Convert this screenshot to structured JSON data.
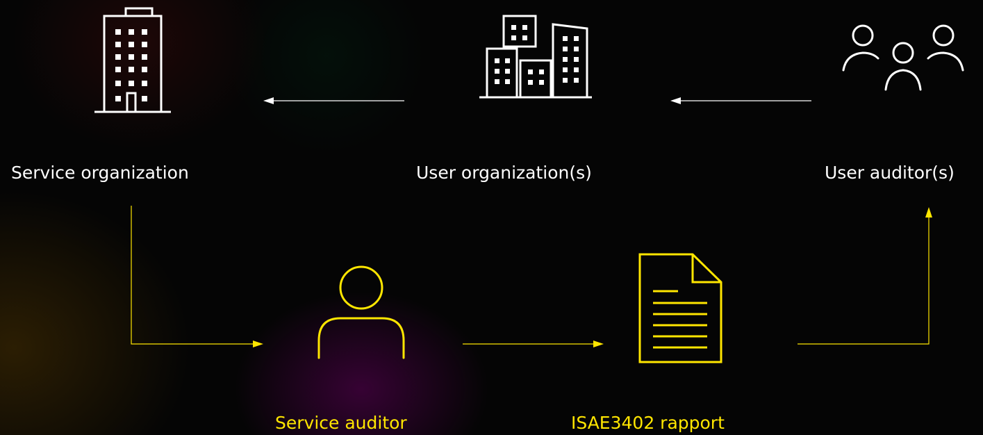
{
  "colors": {
    "background": "#050505",
    "node": "#ffffff",
    "highlight": "#ffe600",
    "connector": "#ffffff"
  },
  "nodes": {
    "service_organization": {
      "label": "Service organization",
      "icon": "office-building-icon"
    },
    "user_organizations": {
      "label": "User organization(s)",
      "icon": "city-buildings-icon"
    },
    "user_auditors": {
      "label": "User auditor(s)",
      "icon": "user-group-icon"
    },
    "service_auditor": {
      "label": "Service auditor",
      "icon": "person-icon"
    },
    "isae_report": {
      "label": "ISAE3402 rapport",
      "icon": "document-icon"
    }
  }
}
